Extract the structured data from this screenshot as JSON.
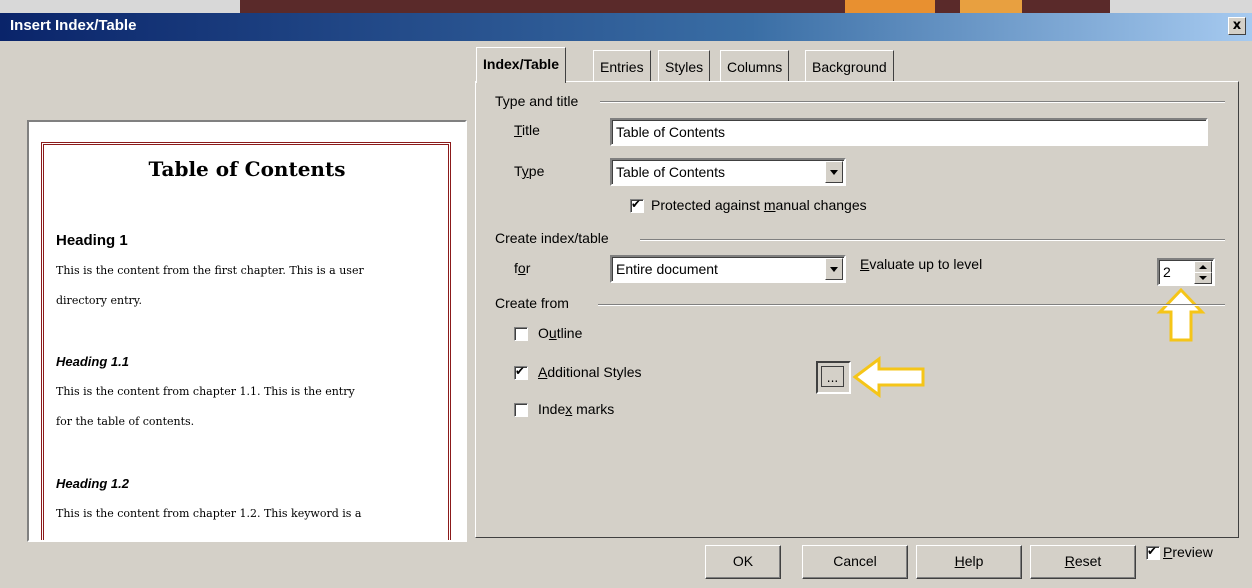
{
  "window": {
    "title": "Insert Index/Table",
    "close_glyph": "x"
  },
  "preview": {
    "title": "Table of Contents",
    "heading1": "Heading 1",
    "para1_line1": "This is the content from the first chapter. This is a user",
    "para1_line2": "directory entry.",
    "heading1_1": "Heading 1.1",
    "para2_line1": "This is the content from chapter 1.1. This is the entry",
    "para2_line2": "for the table of contents.",
    "heading1_2": "Heading 1.2",
    "para3_line1": "This is the content from chapter 1.2. This keyword is a"
  },
  "tabs": [
    {
      "label": "Index/Table",
      "active": true
    },
    {
      "label": "Entries"
    },
    {
      "label": "Styles"
    },
    {
      "label": "Columns"
    },
    {
      "label": "Background"
    }
  ],
  "type_and_title": {
    "section_label": "Type and title",
    "title_label": "Title",
    "title_value": "Table of Contents",
    "type_label": "Type",
    "type_value": "Table of Contents",
    "protected_label": "Protected against manual changes",
    "protected_checked": true
  },
  "create_index": {
    "section_label": "Create index/table",
    "for_label": "for",
    "for_value": "Entire document",
    "evaluate_label": "Evaluate up to level",
    "level_value": "2"
  },
  "create_from": {
    "section_label": "Create from",
    "outline_label": "Outline",
    "outline_checked": false,
    "additional_label": "Additional Styles",
    "additional_checked": true,
    "ellipsis_label": "...",
    "index_marks_label": "Index marks",
    "index_marks_checked": false
  },
  "buttons": {
    "ok": "OK",
    "cancel": "Cancel",
    "help": "Help",
    "reset": "Reset"
  },
  "preview_toggle": {
    "label": "Preview",
    "checked": true
  },
  "colors": {
    "titlebar_start": "#0a246a",
    "arrow": "#f5c518",
    "preview_border": "#8b1a1a"
  }
}
